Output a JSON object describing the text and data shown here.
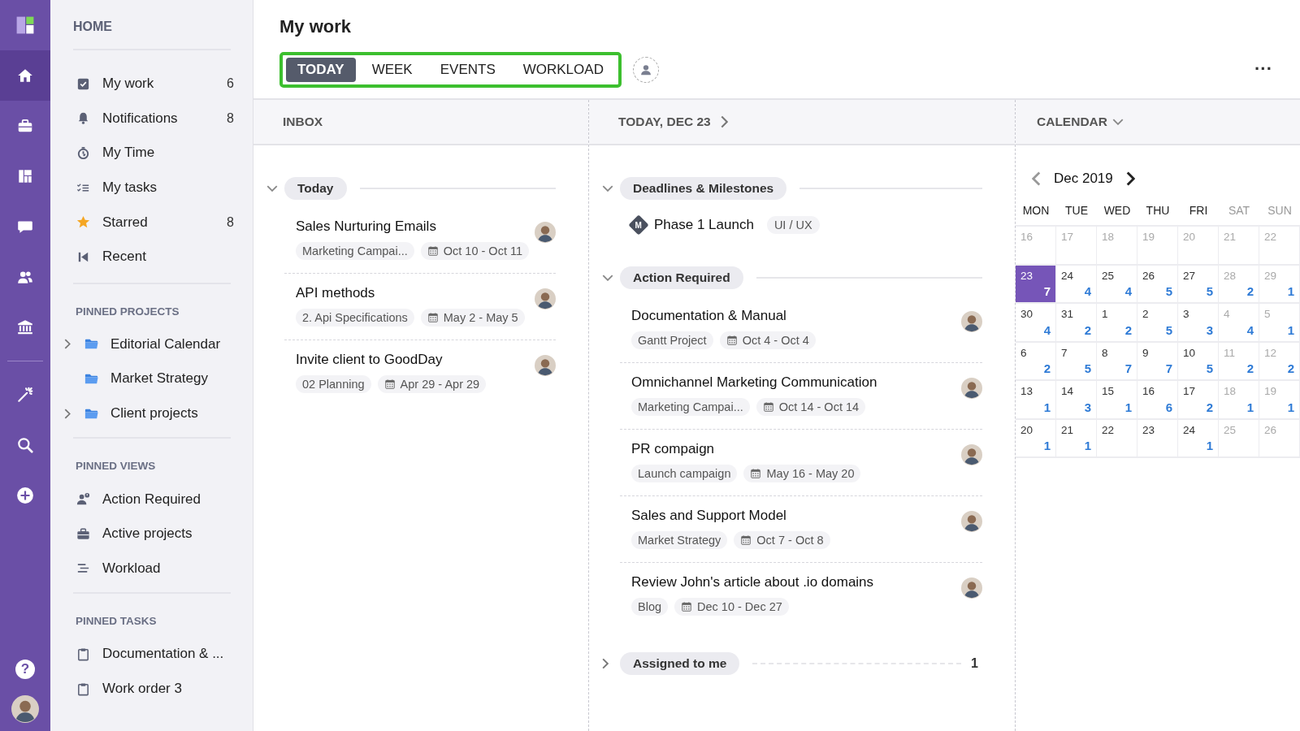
{
  "rail": {
    "items": [
      {
        "kind": "home",
        "selected": true
      },
      {
        "kind": "briefcase",
        "selected": false
      },
      {
        "kind": "board",
        "selected": false
      },
      {
        "kind": "chat",
        "selected": false
      },
      {
        "kind": "people",
        "selected": false
      },
      {
        "kind": "bank",
        "selected": false
      },
      {
        "kind": "separator"
      },
      {
        "kind": "wand",
        "selected": false
      },
      {
        "kind": "search",
        "selected": false
      },
      {
        "kind": "add",
        "selected": false
      }
    ],
    "bottom": [
      {
        "kind": "help",
        "glyph": "?"
      },
      {
        "kind": "avatar"
      }
    ]
  },
  "sidebar": {
    "title": "HOME",
    "items": [
      {
        "kind": "checkbox",
        "label": "My work",
        "count": "6"
      },
      {
        "kind": "bell",
        "label": "Notifications",
        "count": "8"
      },
      {
        "kind": "timer",
        "label": "My Time"
      },
      {
        "kind": "checklist",
        "label": "My tasks"
      },
      {
        "kind": "star",
        "label": "Starred",
        "count": "8"
      },
      {
        "kind": "recent",
        "label": "Recent"
      }
    ],
    "sections": [
      {
        "title": "PINNED PROJECTS",
        "items": [
          {
            "kind": "folder",
            "label": "Editorial Calendar",
            "expandable": true
          },
          {
            "kind": "folder",
            "label": "Market Strategy",
            "expandable": false
          },
          {
            "kind": "folder",
            "label": "Client projects",
            "expandable": true
          }
        ]
      },
      {
        "title": "PINNED VIEWS",
        "items": [
          {
            "kind": "person-alert",
            "label": "Action Required"
          },
          {
            "kind": "briefcase",
            "label": "Active projects"
          },
          {
            "kind": "workload",
            "label": "Workload"
          }
        ]
      },
      {
        "title": "PINNED TASKS",
        "items": [
          {
            "kind": "clipboard",
            "label": "Documentation & ..."
          },
          {
            "kind": "clipboard",
            "label": "Work order 3"
          }
        ]
      }
    ]
  },
  "header": {
    "title": "My work",
    "tabs": [
      {
        "label": "TODAY",
        "selected": true
      },
      {
        "label": "WEEK",
        "selected": false
      },
      {
        "label": "EVENTS",
        "selected": false
      },
      {
        "label": "WORKLOAD",
        "selected": false
      }
    ],
    "more": "···"
  },
  "inbox": {
    "title": "INBOX",
    "groups": [
      {
        "title": "Today",
        "expanded": true,
        "items": [
          {
            "kind": "task",
            "title": "Sales Nurturing Emails",
            "project": "Marketing Campai...",
            "dates": "Oct 10 - Oct 11"
          },
          {
            "kind": "task",
            "title": "API methods",
            "project": "2. Api Specifications",
            "dates": "May 2 - May 5"
          },
          {
            "kind": "task",
            "title": "Invite client to GoodDay",
            "project": "02 Planning",
            "dates": "Apr 29 - Apr 29"
          }
        ]
      }
    ]
  },
  "today": {
    "title": "TODAY, DEC 23",
    "groups": [
      {
        "title": "Deadlines & Milestones",
        "expanded": true,
        "items": [
          {
            "kind": "milestone",
            "badge": "M",
            "title": "Phase 1 Launch",
            "tag": "UI / UX"
          }
        ]
      },
      {
        "title": "Action Required",
        "expanded": true,
        "items": [
          {
            "kind": "task",
            "title": "Documentation & Manual",
            "project": "Gantt Project",
            "dates": "Oct 4 - Oct 4"
          },
          {
            "kind": "task",
            "title": "Omnichannel Marketing Communication",
            "project": "Marketing Campai...",
            "dates": "Oct 14 - Oct 14"
          },
          {
            "kind": "task",
            "title": "PR compaign",
            "project": "Launch campaign",
            "dates": "May 16 - May 20"
          },
          {
            "kind": "task",
            "title": "Sales and Support Model",
            "project": "Market Strategy",
            "dates": "Oct 7 - Oct 8"
          },
          {
            "kind": "task",
            "title": "Review John's article about .io domains",
            "project": "Blog",
            "dates": "Dec 10 - Dec 27"
          }
        ]
      },
      {
        "title": "Assigned to me",
        "expanded": false,
        "count": "1"
      }
    ]
  },
  "calendar": {
    "title": "CALENDAR",
    "month": "Dec 2019",
    "weekdays": [
      {
        "label": "MON",
        "weekend": false
      },
      {
        "label": "TUE",
        "weekend": false
      },
      {
        "label": "WED",
        "weekend": false
      },
      {
        "label": "THU",
        "weekend": false
      },
      {
        "label": "FRI",
        "weekend": false
      },
      {
        "label": "SAT",
        "weekend": true
      },
      {
        "label": "SUN",
        "weekend": true
      }
    ],
    "weeks": [
      [
        {
          "day": "16",
          "muted": true,
          "selected": false
        },
        {
          "day": "17",
          "muted": true,
          "selected": false
        },
        {
          "day": "18",
          "muted": true,
          "selected": false
        },
        {
          "day": "19",
          "muted": true,
          "selected": false
        },
        {
          "day": "20",
          "muted": true,
          "selected": false
        },
        {
          "day": "21",
          "muted": true,
          "selected": false
        },
        {
          "day": "22",
          "muted": true,
          "selected": false
        }
      ],
      [
        {
          "day": "23",
          "count": "7",
          "muted": false,
          "selected": true
        },
        {
          "day": "24",
          "count": "4",
          "muted": false,
          "selected": false
        },
        {
          "day": "25",
          "count": "4",
          "muted": false,
          "selected": false
        },
        {
          "day": "26",
          "count": "5",
          "muted": false,
          "selected": false
        },
        {
          "day": "27",
          "count": "5",
          "muted": false,
          "selected": false
        },
        {
          "day": "28",
          "count": "2",
          "muted": true,
          "selected": false
        },
        {
          "day": "29",
          "count": "1",
          "muted": true,
          "selected": false
        }
      ],
      [
        {
          "day": "30",
          "count": "4",
          "muted": false,
          "selected": false
        },
        {
          "day": "31",
          "count": "2",
          "muted": false,
          "selected": false
        },
        {
          "day": "1",
          "count": "2",
          "muted": false,
          "selected": false
        },
        {
          "day": "2",
          "count": "5",
          "muted": false,
          "selected": false
        },
        {
          "day": "3",
          "count": "3",
          "muted": false,
          "selected": false
        },
        {
          "day": "4",
          "count": "4",
          "muted": true,
          "selected": false
        },
        {
          "day": "5",
          "count": "1",
          "muted": true,
          "selected": false
        }
      ],
      [
        {
          "day": "6",
          "count": "2",
          "muted": false,
          "selected": false
        },
        {
          "day": "7",
          "count": "5",
          "muted": false,
          "selected": false
        },
        {
          "day": "8",
          "count": "7",
          "muted": false,
          "selected": false
        },
        {
          "day": "9",
          "count": "7",
          "muted": false,
          "selected": false
        },
        {
          "day": "10",
          "count": "5",
          "muted": false,
          "selected": false
        },
        {
          "day": "11",
          "count": "2",
          "muted": true,
          "selected": false
        },
        {
          "day": "12",
          "count": "2",
          "muted": true,
          "selected": false
        }
      ],
      [
        {
          "day": "13",
          "count": "1",
          "muted": false,
          "selected": false
        },
        {
          "day": "14",
          "count": "3",
          "muted": false,
          "selected": false
        },
        {
          "day": "15",
          "count": "1",
          "muted": false,
          "selected": false
        },
        {
          "day": "16",
          "count": "6",
          "muted": false,
          "selected": false
        },
        {
          "day": "17",
          "count": "2",
          "muted": false,
          "selected": false
        },
        {
          "day": "18",
          "count": "1",
          "muted": true,
          "selected": false
        },
        {
          "day": "19",
          "count": "1",
          "muted": true,
          "selected": false
        }
      ],
      [
        {
          "day": "20",
          "count": "1",
          "muted": false,
          "selected": false
        },
        {
          "day": "21",
          "count": "1",
          "muted": false,
          "selected": false
        },
        {
          "day": "22",
          "muted": false,
          "selected": false
        },
        {
          "day": "23",
          "muted": false,
          "selected": false
        },
        {
          "day": "24",
          "count": "1",
          "muted": false,
          "selected": false
        },
        {
          "day": "25",
          "muted": true,
          "selected": false
        },
        {
          "day": "26",
          "muted": true,
          "selected": false
        }
      ]
    ]
  }
}
